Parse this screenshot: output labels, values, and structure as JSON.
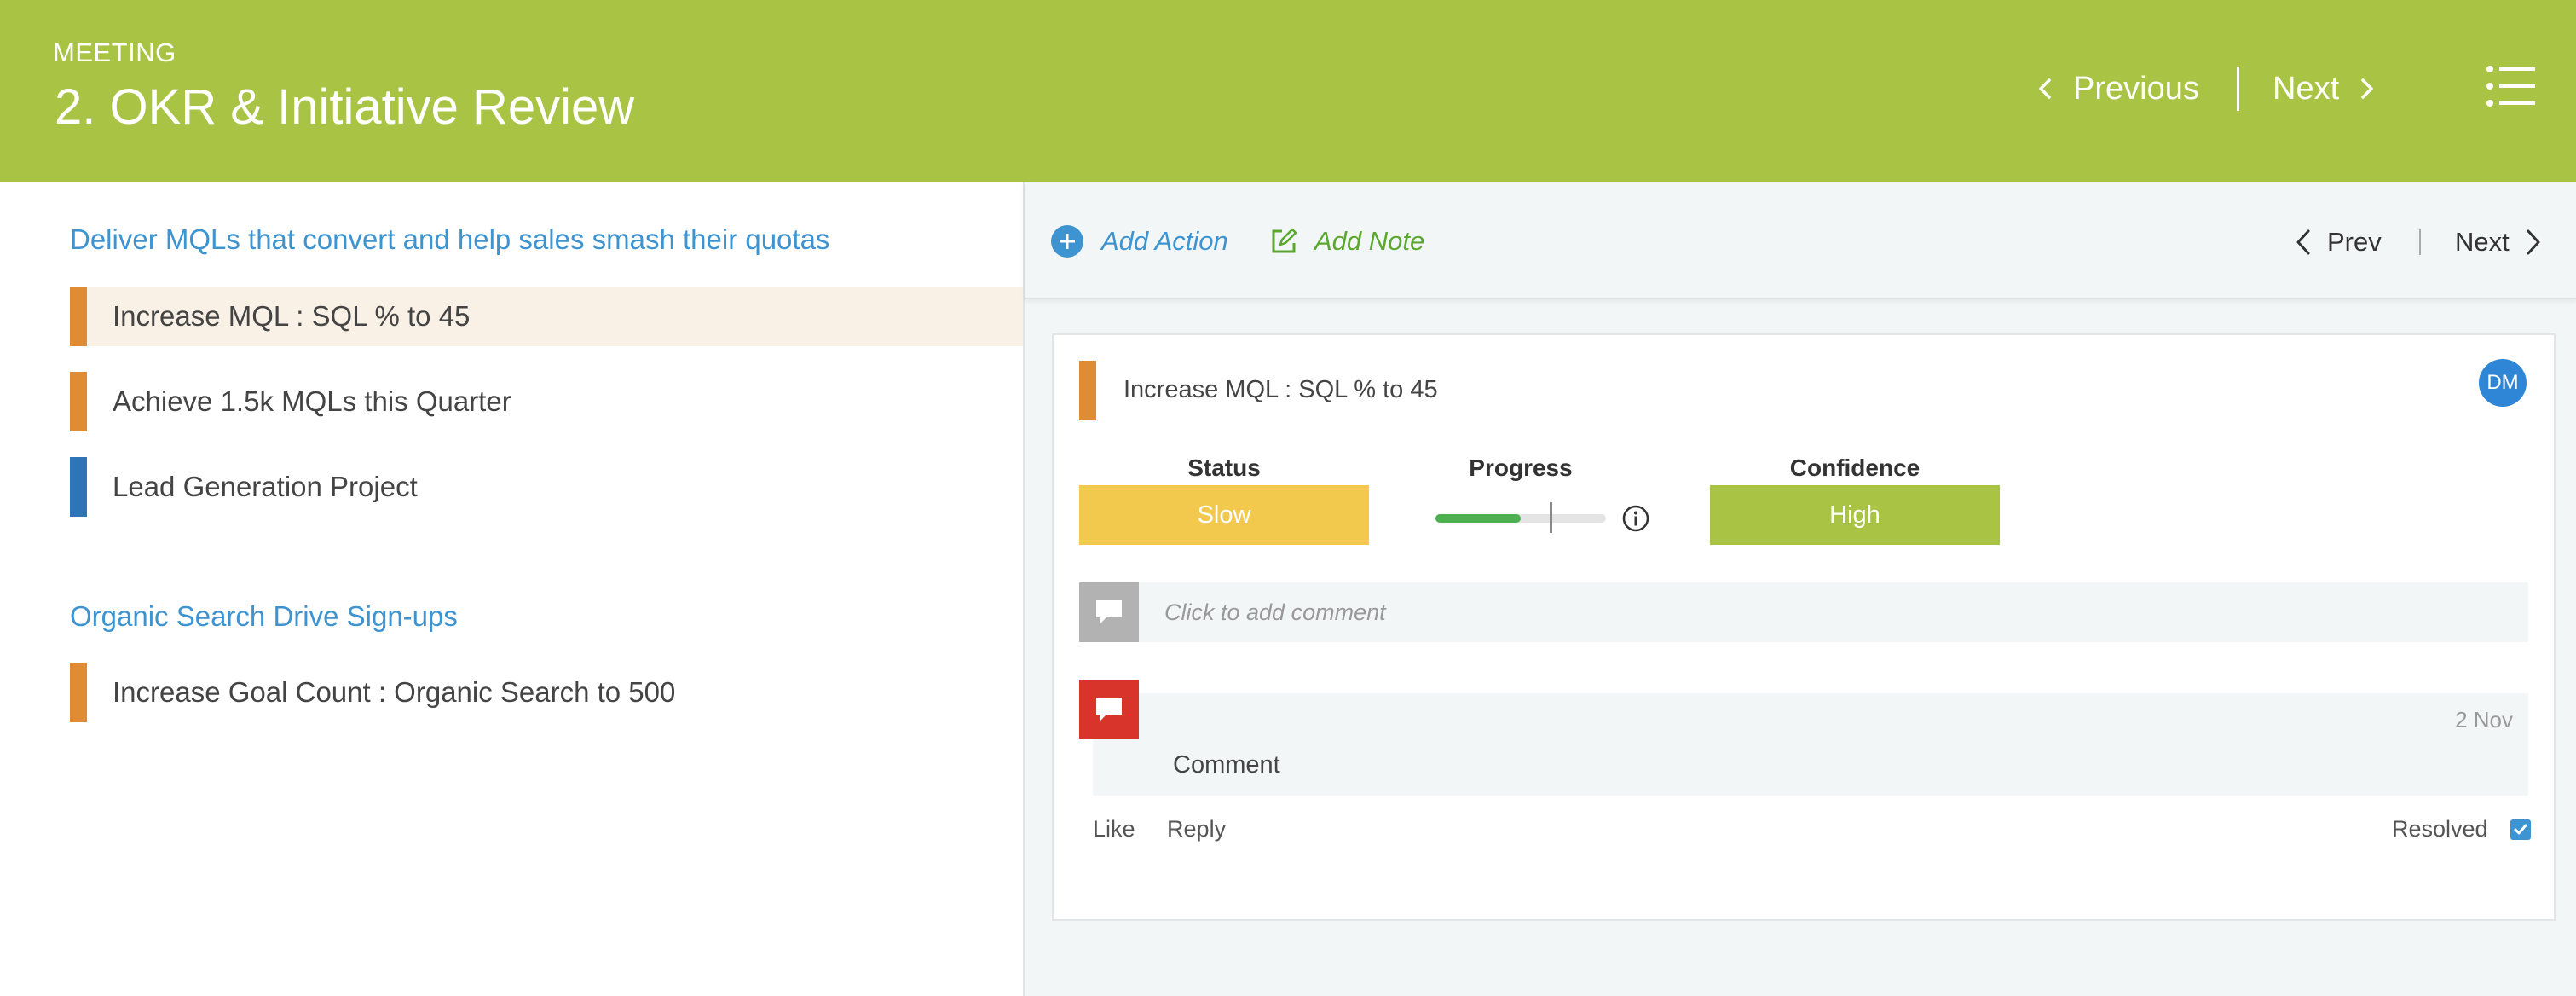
{
  "header": {
    "eyebrow": "MEETING",
    "title": "2. OKR & Initiative Review",
    "prev_label": "Previous",
    "next_label": "Next",
    "background": "#a9c444"
  },
  "left": {
    "groups": [
      {
        "title": "Deliver MQLs that convert and help sales smash their quotas",
        "items": [
          {
            "label": "Increase MQL : SQL % to 45",
            "color": "#e08c34",
            "selected": true
          },
          {
            "label": "Achieve 1.5k MQLs this Quarter",
            "color": "#e08c34"
          },
          {
            "label": "Lead Generation Project",
            "color": "#2f75b5"
          }
        ]
      },
      {
        "title": "Organic Search Drive Sign-ups",
        "items": [
          {
            "label": "Increase Goal Count : Organic Search to 500",
            "color": "#e08c34"
          }
        ]
      }
    ]
  },
  "toolbar": {
    "add_action": "Add Action",
    "add_note": "Add Note",
    "prev_label": "Prev",
    "next_label": "Next"
  },
  "card": {
    "title": "Increase MQL : SQL % to 45",
    "avatar_initials": "DM",
    "status_label": "Status",
    "status_value": "Slow",
    "status_color": "#f2c94c",
    "progress_label": "Progress",
    "progress_fraction": 0.5,
    "confidence_label": "Confidence",
    "confidence_value": "High",
    "confidence_color": "#a9c444",
    "comment_placeholder": "Click to add comment",
    "comment": {
      "date": "2 Nov",
      "text": "Comment",
      "like": "Like",
      "reply": "Reply",
      "resolved_label": "Resolved",
      "resolved": true
    }
  }
}
